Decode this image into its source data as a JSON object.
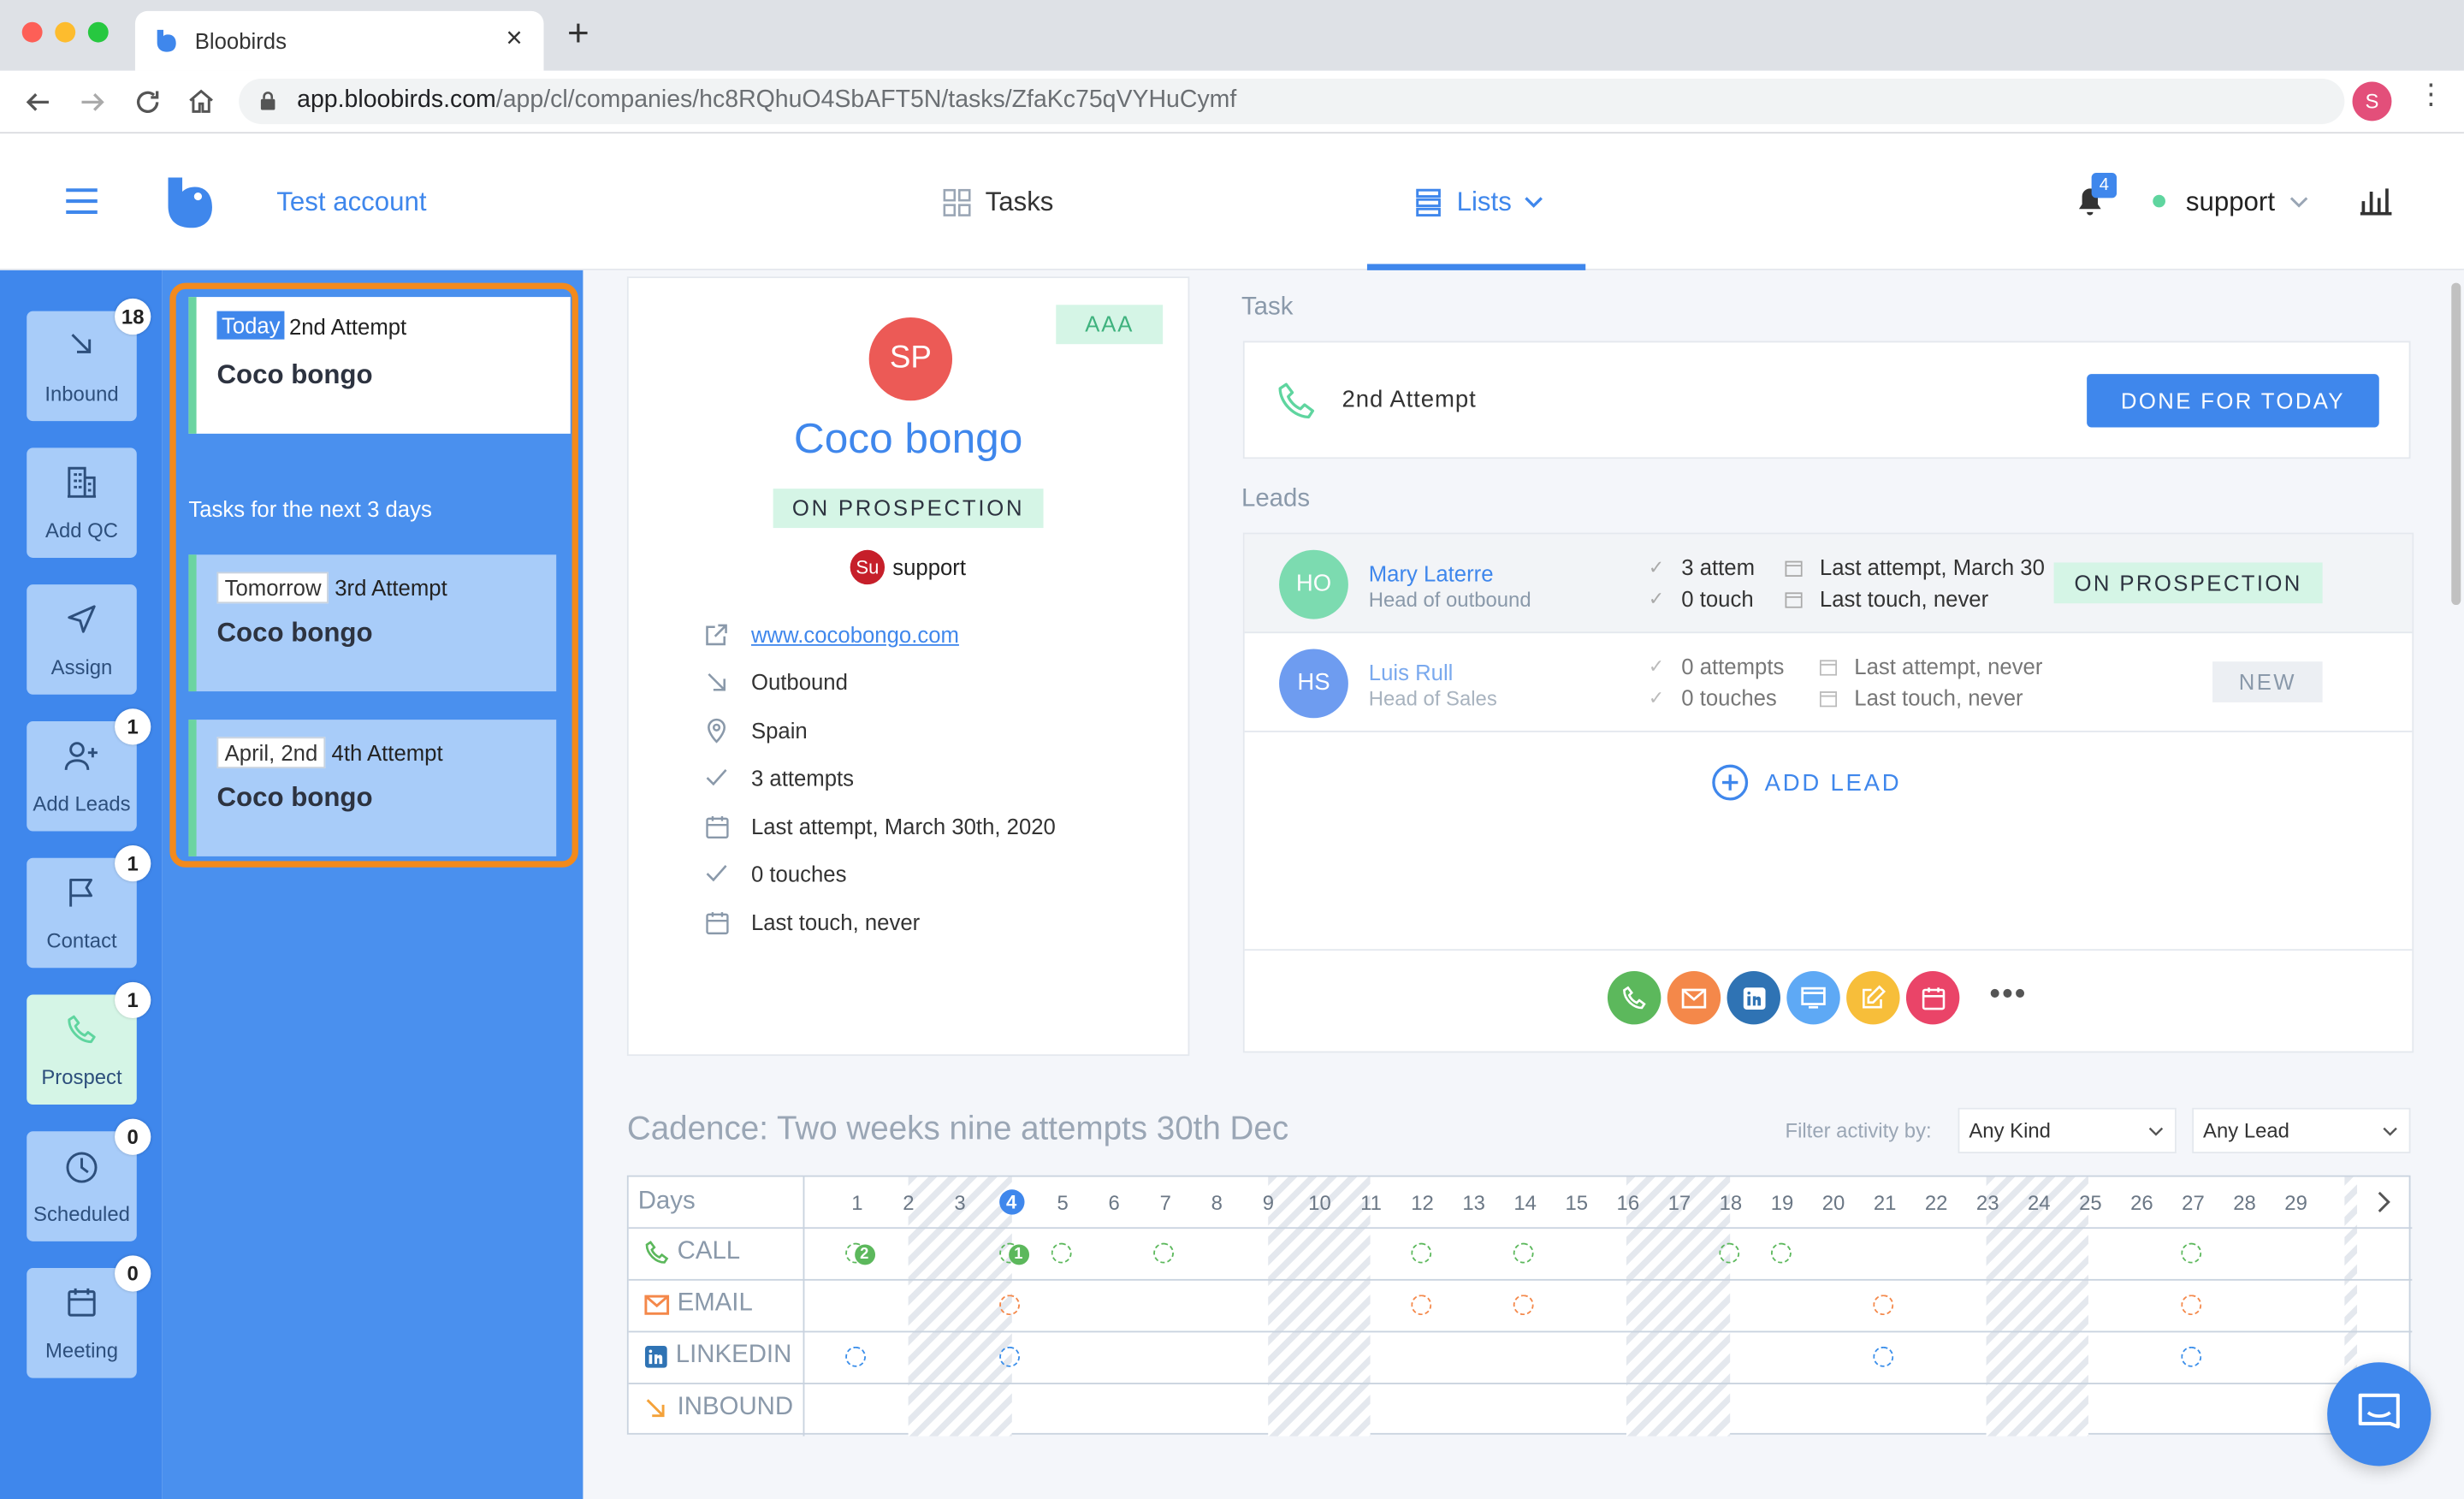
{
  "browser": {
    "tab_title": "Bloobirds",
    "url_host": "app.bloobirds.com",
    "url_path": "/app/cl/companies/hc8RQhuO4SbAFT5N/tasks/ZfaKc75qVYHuCymf",
    "profile_initial": "S"
  },
  "header": {
    "account": "Test account",
    "nav_tasks": "Tasks",
    "nav_lists": "Lists",
    "notifications": "4",
    "user": "support"
  },
  "rail": [
    {
      "label": "Inbound",
      "badge": "18",
      "icon": "arrow-down-right-icon"
    },
    {
      "label": "Add QC",
      "badge": "",
      "icon": "building-icon"
    },
    {
      "label": "Assign",
      "badge": "",
      "icon": "send-icon"
    },
    {
      "label": "Add Leads",
      "badge": "1",
      "icon": "user-plus-icon"
    },
    {
      "label": "Contact",
      "badge": "1",
      "icon": "flag-icon"
    },
    {
      "label": "Prospect",
      "badge": "1",
      "icon": "phone-icon"
    },
    {
      "label": "Scheduled",
      "badge": "0",
      "icon": "clock-icon"
    },
    {
      "label": "Meeting",
      "badge": "0",
      "icon": "calendar-icon"
    }
  ],
  "tasks": {
    "today": {
      "chip": "Today",
      "attempt": "2nd Attempt",
      "company": "Coco bongo"
    },
    "next_title": "Tasks for the next 3 days",
    "upcoming": [
      {
        "chip": "Tomorrow",
        "attempt": "3rd Attempt",
        "company": "Coco bongo"
      },
      {
        "chip": "April, 2nd",
        "attempt": "4th Attempt",
        "company": "Coco bongo"
      }
    ]
  },
  "company": {
    "initials": "SP",
    "name": "Coco bongo",
    "tier": "AAA",
    "status": "ON PROSPECTION",
    "owner_initials": "Su",
    "owner": "support",
    "website": "www.cocobongo.com",
    "source": "Outbound",
    "country": "Spain",
    "attempts": "3 attempts",
    "last_attempt": "Last attempt, March 30th, 2020",
    "touches": "0 touches",
    "last_touch": "Last touch, never"
  },
  "task_panel": {
    "heading": "Task",
    "title": "2nd Attempt",
    "done_button": "DONE FOR TODAY"
  },
  "leads_panel": {
    "heading": "Leads",
    "leads": [
      {
        "initials": "HO",
        "name": "Mary Laterre",
        "role": "Head of outbound",
        "attempts": "3 attem",
        "touches": "0 touch",
        "last_attempt": "Last attempt, March 30",
        "last_touch": "Last touch, never",
        "status": "ON PROSPECTION",
        "color": "#5fd59f"
      },
      {
        "initials": "HS",
        "name": "Luis Rull",
        "role": "Head of Sales",
        "attempts": "0 attempts",
        "touches": "0 touches",
        "last_attempt": "Last attempt, never",
        "last_touch": "Last touch, never",
        "status": "NEW",
        "color": "#6e9cf0"
      }
    ],
    "add_lead": "ADD LEAD"
  },
  "actions": [
    {
      "icon": "phone-icon",
      "color": "#5cb85c"
    },
    {
      "icon": "mail-icon",
      "color": "#f4884a"
    },
    {
      "icon": "linkedin-icon",
      "color": "#2f73b4"
    },
    {
      "icon": "website-icon",
      "color": "#5ea9f5"
    },
    {
      "icon": "note-icon",
      "color": "#f7be3a"
    },
    {
      "icon": "calendar-icon",
      "color": "#ea4468"
    }
  ],
  "cadence": {
    "title": "Cadence: Two weeks nine attempts 30th Dec",
    "filter_label": "Filter activity by:",
    "filter_kind": "Any Kind",
    "filter_lead": "Any Lead",
    "days_label": "Days",
    "days": [
      "1",
      "2",
      "3",
      "4",
      "5",
      "6",
      "7",
      "8",
      "9",
      "10",
      "11",
      "12",
      "13",
      "14",
      "15",
      "16",
      "17",
      "18",
      "19",
      "20",
      "21",
      "22",
      "23",
      "24",
      "25",
      "26",
      "27",
      "28",
      "29"
    ],
    "today_day": "4",
    "rows": [
      {
        "label": "CALL",
        "color": "#5cb85c",
        "icon": "phone-icon",
        "days": [
          1,
          4,
          5,
          7,
          12,
          14,
          18,
          19,
          27
        ],
        "counts": {
          "1": "2",
          "4": "1"
        }
      },
      {
        "label": "EMAIL",
        "color": "#f4884a",
        "icon": "mail-icon",
        "days": [
          4,
          12,
          14,
          21,
          27
        ],
        "counts": {}
      },
      {
        "label": "LINKEDIN",
        "color": "#3a8eea",
        "icon": "linkedin-icon",
        "days": [
          1,
          4,
          21,
          27
        ],
        "counts": {}
      },
      {
        "label": "INBOUND",
        "color": "#f4a23a",
        "icon": "arrow-down-right-icon",
        "days": [],
        "counts": {}
      }
    ]
  }
}
